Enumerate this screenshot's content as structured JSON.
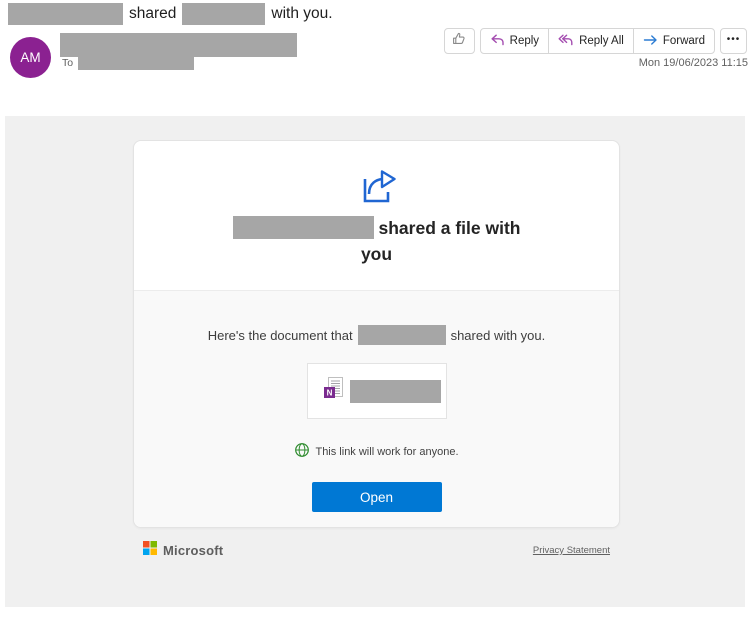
{
  "header": {
    "subject": {
      "word_shared": "shared",
      "suffix": "with you."
    },
    "sender": {
      "avatar_initials": "AM",
      "to_label": "To"
    },
    "timestamp": "Mon 19/06/2023 11:15",
    "actions": {
      "reply": "Reply",
      "reply_all": "Reply All",
      "forward": "Forward",
      "more": "•••"
    }
  },
  "card": {
    "heading_suffix": "shared a file with you",
    "body": {
      "prefix": "Here's the document that",
      "suffix": "shared with you."
    },
    "link_note": "This link will work for anyone.",
    "open_label": "Open"
  },
  "footer": {
    "brand": "Microsoft",
    "privacy_link": "Privacy Statement"
  },
  "icons": {
    "like": "thumbs-up-icon",
    "reply": "reply-arrow-icon",
    "reply_all": "reply-all-arrow-icon",
    "forward": "forward-arrow-icon",
    "more": "more-options-icon",
    "share": "share-file-icon",
    "file": "onenote-document-icon",
    "globe": "globe-icon",
    "microsoft_logo": "microsoft-logo-icon"
  },
  "colors": {
    "open_button_blue": "#0078d4",
    "share_icon_blue": "#2066d2",
    "reply_arrow_purple": "#a44db0",
    "forward_arrow_blue": "#2b7cd3",
    "avatar_purple": "#8b2191",
    "globe_green": "#2e8b2e",
    "redaction_gray": "#a6a6a6",
    "onenote_purple": "#7a2b8f",
    "panel_gray": "#f0f0f0",
    "microsoft_logo_squares": [
      "#f25022",
      "#7fba00",
      "#00a4ef",
      "#ffb900"
    ]
  }
}
